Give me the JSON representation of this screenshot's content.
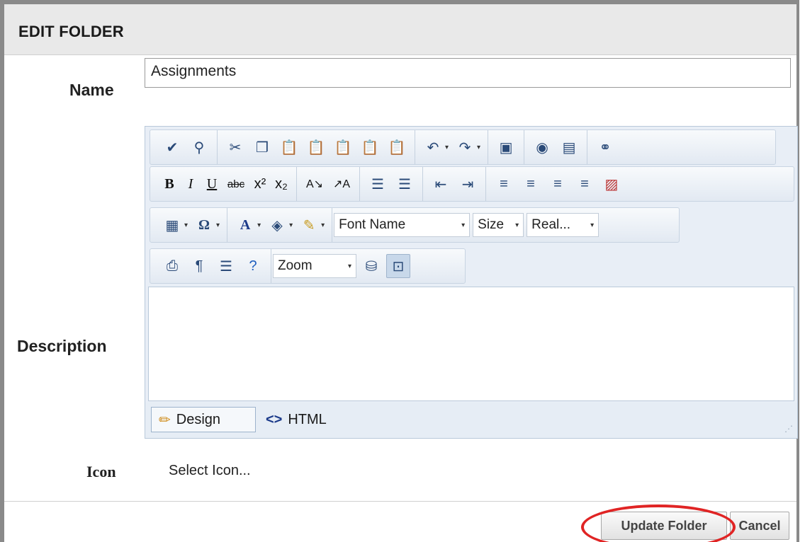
{
  "dialog": {
    "title": "EDIT FOLDER"
  },
  "fields": {
    "name_label": "Name",
    "name_value": "Assignments",
    "description_label": "Description",
    "icon_label": "Icon",
    "icon_link": "Select Icon..."
  },
  "editor": {
    "font_name": "Font Name",
    "size": "Size",
    "real": "Real...",
    "zoom": "Zoom",
    "modes": {
      "design": "Design",
      "html": "HTML"
    }
  },
  "buttons": {
    "update": "Update Folder",
    "cancel": "Cancel"
  },
  "colors": {
    "highlight": "#e02424",
    "toolbar_icon": "#2a4a78"
  },
  "icons": {
    "row1": [
      "spellcheck-icon",
      "find-replace-icon",
      "cut-icon",
      "copy-icon",
      "paste-icon",
      "paste-from-word-icon",
      "paste-word-cleanup-icon",
      "paste-plain-icon",
      "paste-html-icon",
      "undo-icon",
      "redo-icon",
      "image-manager-icon",
      "media-icon",
      "document-manager-icon",
      "hyperlink-icon"
    ],
    "row2": [
      "bold-icon",
      "italic-icon",
      "underline-icon",
      "strikethrough-icon",
      "superscript-icon",
      "subscript-icon",
      "convert-lower-icon",
      "convert-upper-icon",
      "numbered-list-icon",
      "bullet-list-icon",
      "outdent-icon",
      "indent-icon",
      "align-left-icon",
      "align-center-icon",
      "align-right-icon",
      "justify-icon",
      "remove-alignment-icon"
    ],
    "row3": [
      "table-icon",
      "symbol-icon",
      "font-color-icon",
      "background-color-icon",
      "format-stripper-icon"
    ],
    "row4": [
      "print-icon",
      "paragraph-icon",
      "format-icon",
      "help-icon",
      "module-manager-icon",
      "toggle-screen-icon"
    ]
  }
}
